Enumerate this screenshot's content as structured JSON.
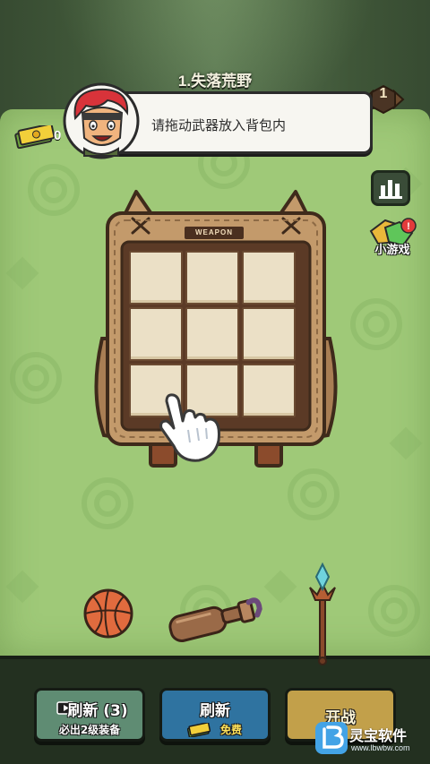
{
  "stage": {
    "title": "1.失落荒野",
    "level": "1"
  },
  "hint": {
    "text": "请拖动武器放入背包内"
  },
  "currency": {
    "cash": "0"
  },
  "sidebar": {
    "minigame_label": "小游戏",
    "minigame_badge": "!"
  },
  "backpack": {
    "tag": "WEAPON",
    "slots": [
      "",
      "",
      "",
      "",
      "",
      "",
      "",
      "",
      ""
    ]
  },
  "items": [
    "basketball",
    "bottle-club",
    "crystal-staff"
  ],
  "buttons": {
    "refresh_ad": {
      "label": "刷新 (3)",
      "sub": "必出2级装备"
    },
    "refresh_free": {
      "label": "刷新",
      "sub": "免费"
    },
    "start": {
      "label": "开战"
    }
  },
  "watermark": {
    "name": "灵宝软件",
    "url": "www.lbwbw.com"
  },
  "colors": {
    "field": "#9fc978",
    "backpack": "#c39a6b",
    "button_blue": "#2f73a0",
    "button_green": "#5f8c73",
    "button_gold": "#c2a04a"
  }
}
